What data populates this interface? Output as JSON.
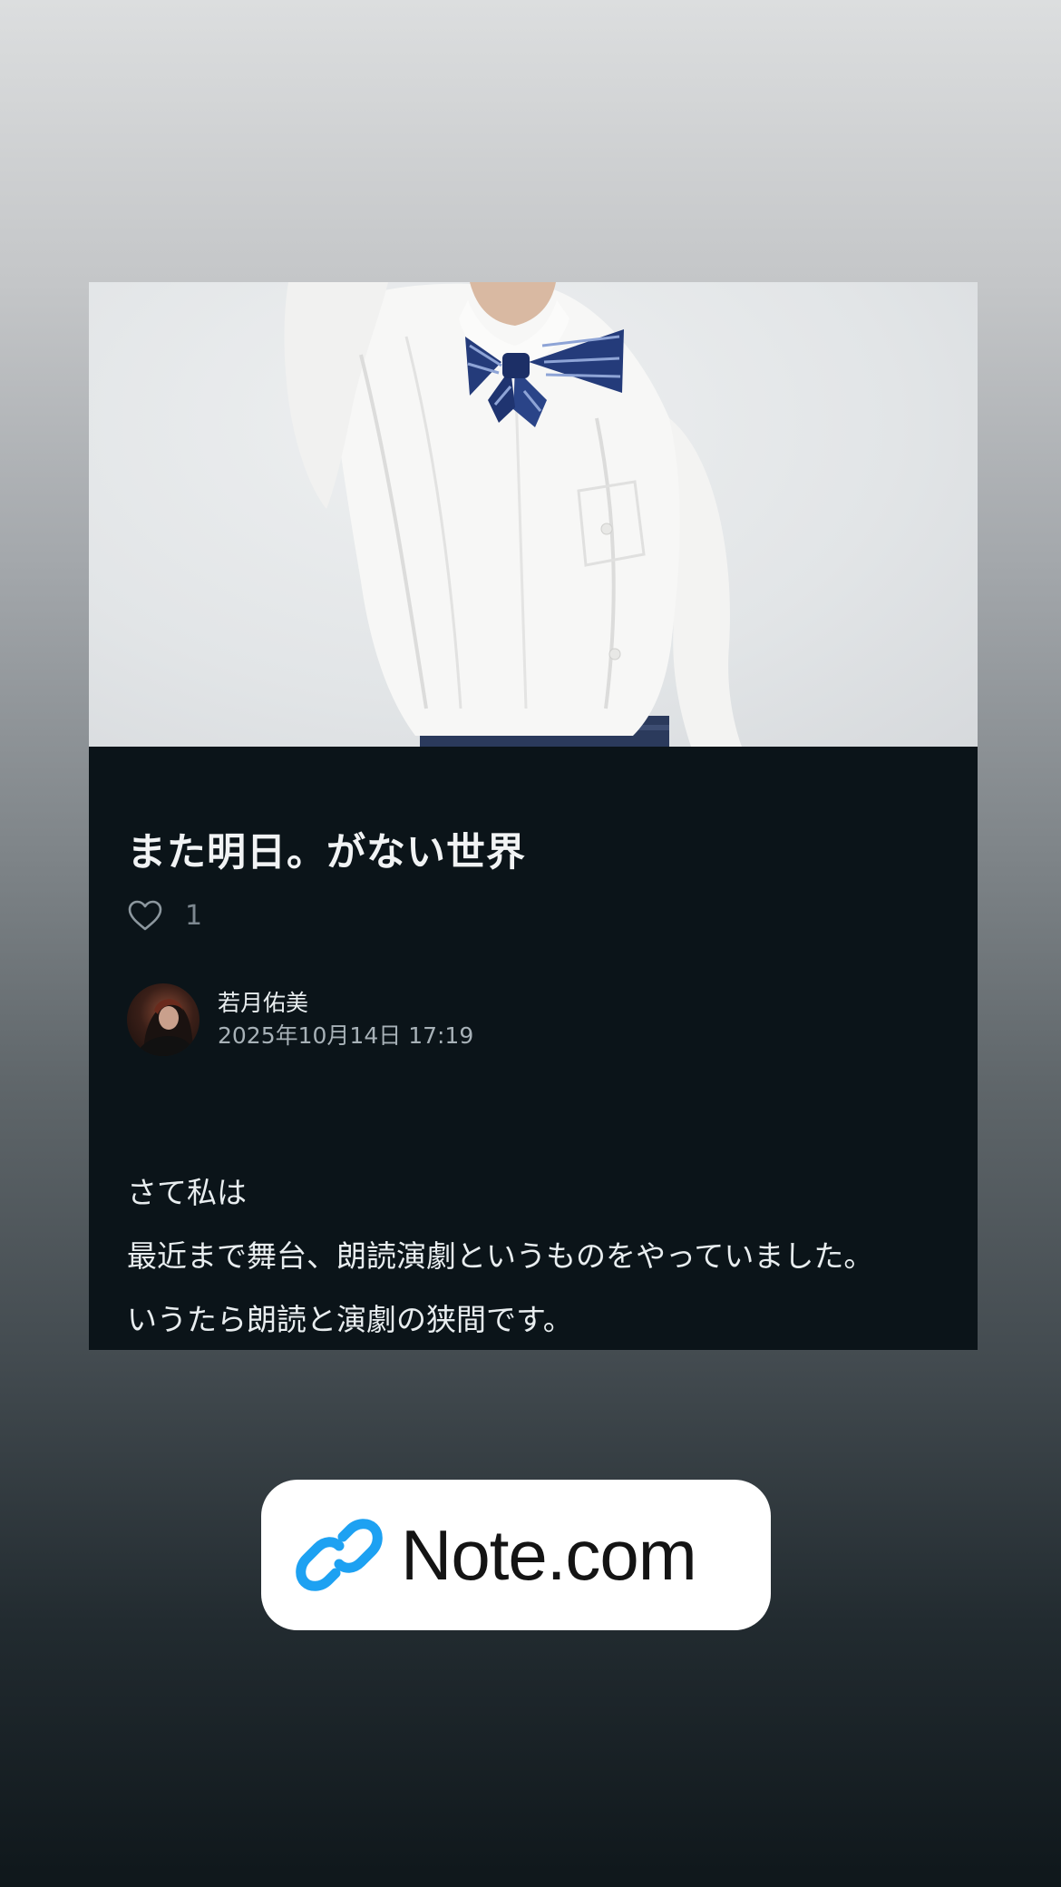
{
  "post": {
    "title": "また明日。がない世界",
    "like_count": "1",
    "author_name": "若月佑美",
    "date": "2025年10月14日 17:19",
    "body_lines": [
      "さて私は",
      "最近まで舞台、朗読演劇というものをやっていました。",
      "いうたら朗読と演劇の狭間です。"
    ]
  },
  "link": {
    "label": "Note.com",
    "icon": "link-icon"
  },
  "colors": {
    "card_background": "#0b1419",
    "link_icon": "#1da1f2",
    "title_text": "#f1f3f4",
    "meta_text": "#a7b1b7"
  }
}
